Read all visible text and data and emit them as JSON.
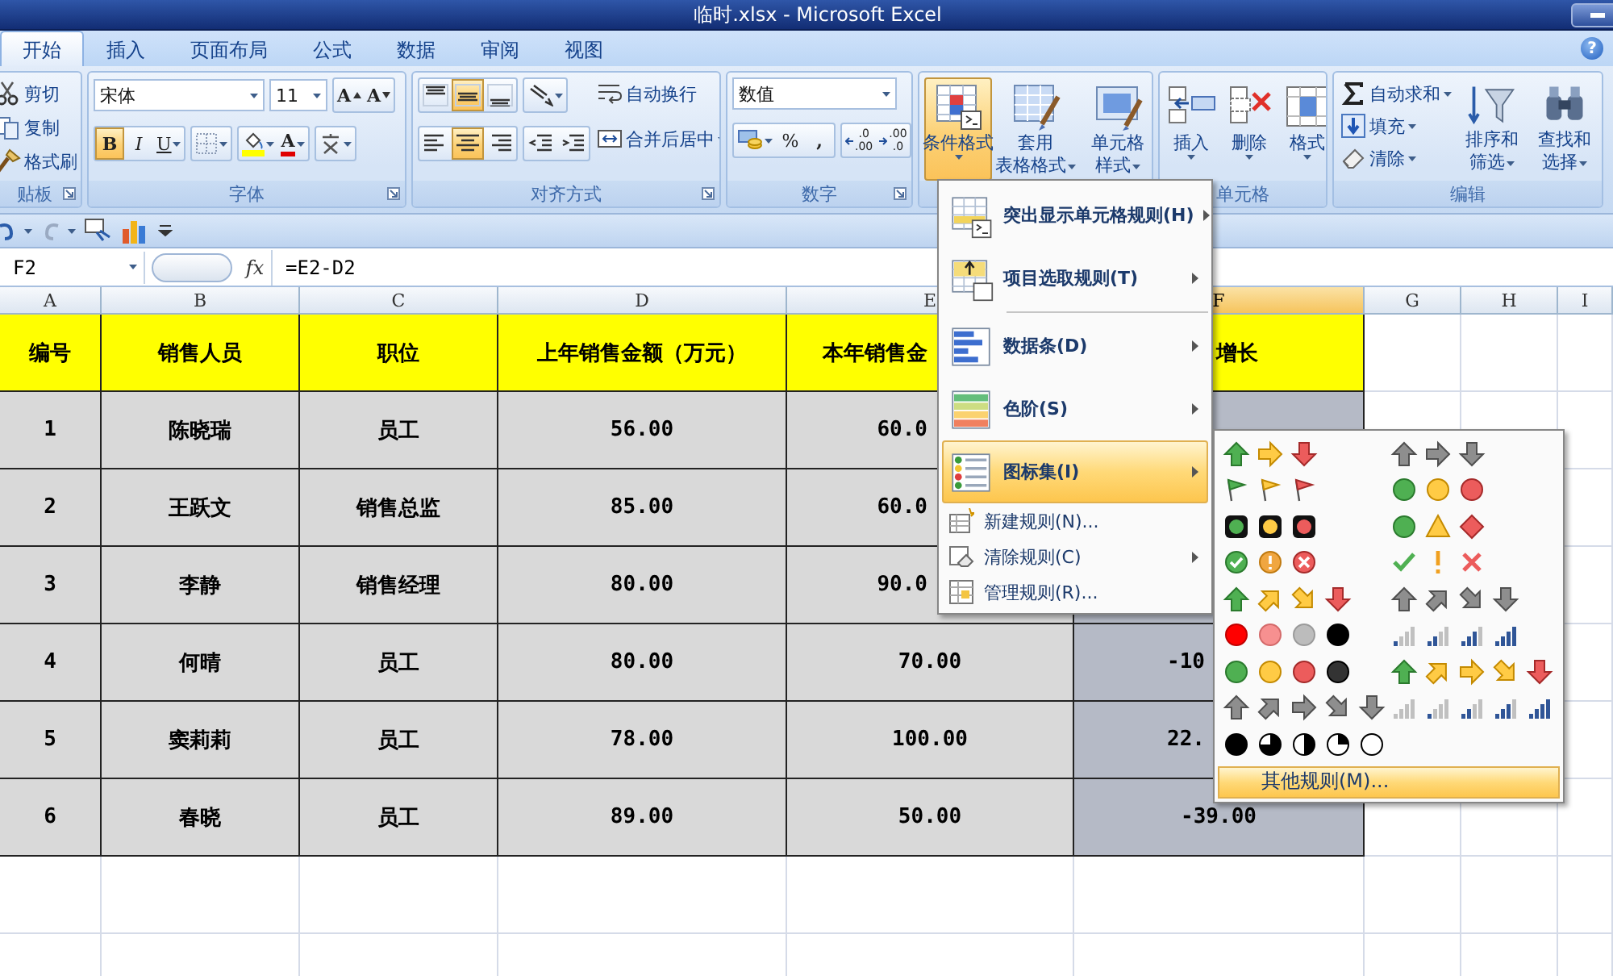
{
  "window": {
    "title": "临时.xlsx - Microsoft Excel"
  },
  "tabs": [
    {
      "label": "开始",
      "selected": true
    },
    {
      "label": "插入",
      "selected": false
    },
    {
      "label": "页面布局",
      "selected": false
    },
    {
      "label": "公式",
      "selected": false
    },
    {
      "label": "数据",
      "selected": false
    },
    {
      "label": "审阅",
      "selected": false
    },
    {
      "label": "视图",
      "selected": false
    }
  ],
  "help": "?",
  "ribbon": {
    "clipboard": {
      "label": "贴板",
      "items": [
        {
          "kind": "cut",
          "label": "剪切"
        },
        {
          "kind": "copy",
          "label": "复制"
        },
        {
          "kind": "painter",
          "label": "格式刷"
        }
      ]
    },
    "font": {
      "label": "字体",
      "name": "宋体",
      "size": "11",
      "size_buttons": [
        {
          "kind": "grow",
          "label": "A"
        },
        {
          "kind": "shrink",
          "label": "A"
        }
      ],
      "style_buttons": [
        {
          "kind": "bold",
          "label": "B",
          "on": true
        },
        {
          "kind": "italic",
          "label": "I",
          "on": false
        },
        {
          "kind": "underline",
          "label": "U",
          "on": false
        }
      ],
      "color_label": "A"
    },
    "alignment": {
      "label": "对齐方式",
      "vertical": [
        {
          "kind": "top",
          "on": false
        },
        {
          "kind": "middle",
          "on": true
        },
        {
          "kind": "bottom",
          "on": false
        }
      ],
      "horizontal": [
        {
          "kind": "left",
          "on": false
        },
        {
          "kind": "center",
          "on": true
        },
        {
          "kind": "right",
          "on": false
        }
      ],
      "wrap": "自动换行",
      "merge": "合并后居中"
    },
    "number": {
      "label": "数字",
      "format": "数值",
      "percent": "%",
      "comma": ",",
      "decimals": [
        {
          "kind": "increase",
          "top": ".0",
          "bottom": ".00"
        },
        {
          "kind": "decrease",
          "top": ".00",
          "bottom": ".0"
        }
      ]
    },
    "styles": [
      {
        "kind": "conditional",
        "lines": [
          "条件格式"
        ],
        "pressed": true
      },
      {
        "kind": "table",
        "lines": [
          "套用",
          "表格格式"
        ],
        "pressed": false
      },
      {
        "kind": "cell",
        "lines": [
          "单元格",
          "样式"
        ],
        "pressed": false
      }
    ],
    "cells": {
      "label": "单元格",
      "buttons": [
        {
          "kind": "insert",
          "label": "插入"
        },
        {
          "kind": "delete",
          "label": "删除"
        },
        {
          "kind": "format",
          "label": "格式"
        }
      ]
    },
    "editing": {
      "label": "编辑",
      "small": [
        {
          "kind": "sum",
          "label": "自动求和"
        },
        {
          "kind": "fill",
          "label": "填充"
        },
        {
          "kind": "clear",
          "label": "清除"
        }
      ],
      "big": [
        {
          "kind": "sort",
          "lines": [
            "排序和",
            "筛选"
          ]
        },
        {
          "kind": "find",
          "lines": [
            "查找和",
            "选择"
          ]
        }
      ]
    }
  },
  "formula_bar": {
    "cell": "F2",
    "fx": "fx",
    "formula": "=E2-D2"
  },
  "columns": [
    {
      "letter": "A",
      "selected": false
    },
    {
      "letter": "B",
      "selected": false
    },
    {
      "letter": "C",
      "selected": false
    },
    {
      "letter": "D",
      "selected": false
    },
    {
      "letter": "E",
      "selected": false
    },
    {
      "letter": "F",
      "selected": true
    },
    {
      "letter": "G",
      "selected": false
    },
    {
      "letter": "H",
      "selected": false
    },
    {
      "letter": "I",
      "selected": false
    }
  ],
  "table": {
    "header": [
      "编号",
      "销售人员",
      "职位",
      "上年销售金额（万元）",
      "本年销售金",
      "增长"
    ],
    "rows": [
      [
        "1",
        "陈晓瑞",
        "员工",
        "56.00",
        "60.0"
      ],
      [
        "2",
        "王跃文",
        "销售总监",
        "85.00",
        "60.0"
      ],
      [
        "3",
        "李静",
        "销售经理",
        "80.00",
        "90.0"
      ],
      [
        "4",
        "何晴",
        "员工",
        "80.00",
        "70.00",
        "-10"
      ],
      [
        "5",
        "窦莉莉",
        "员工",
        "78.00",
        "100.00",
        "22."
      ],
      [
        "6",
        "春晓",
        "员工",
        "89.00",
        "50.00",
        "-39.00"
      ]
    ]
  },
  "menu": {
    "items": [
      {
        "kind": "highlight",
        "label": "突出显示单元格规则(H)",
        "submenu": true,
        "selected": false
      },
      {
        "kind": "top10",
        "label": "项目选取规则(T)",
        "submenu": true,
        "selected": false
      },
      {
        "kind": "databar",
        "label": "数据条(D)",
        "submenu": true,
        "selected": false
      },
      {
        "kind": "colorscale",
        "label": "色阶(S)",
        "submenu": true,
        "selected": false
      },
      {
        "kind": "iconset",
        "label": "图标集(I)",
        "submenu": true,
        "selected": true
      }
    ],
    "small_items": [
      {
        "kind": "new",
        "label": "新建规则(N)...",
        "submenu": false
      },
      {
        "kind": "clear",
        "label": "清除规则(C)",
        "submenu": true
      },
      {
        "kind": "manage",
        "label": "管理规则(R)...",
        "submenu": false
      }
    ]
  },
  "submenu": {
    "footer": {
      "label": "其他规则(M)...",
      "selected": true
    }
  }
}
